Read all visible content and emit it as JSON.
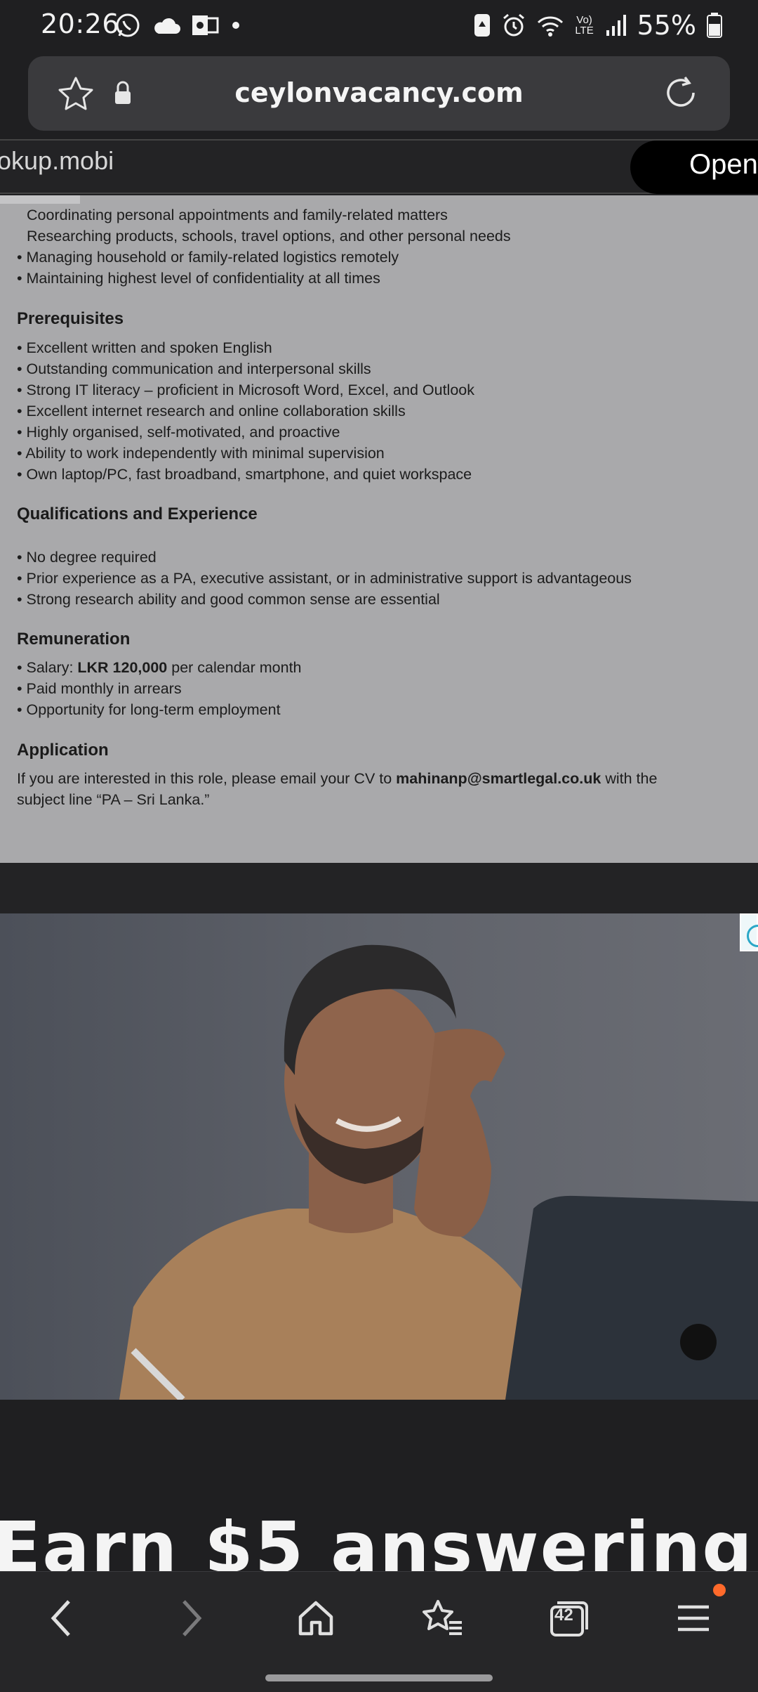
{
  "status_bar": {
    "time": "20:26",
    "battery": "55%",
    "network": "Vo) LTE"
  },
  "browser": {
    "url": "ceylonvacancy.com",
    "tabs_count": "42"
  },
  "ad_banner": {
    "domain": "okup.mobi",
    "open_label": "Open"
  },
  "article": {
    "duties_continued": [
      "Coordinating personal appointments and family-related matters",
      "Researching products, schools, travel options, and other personal needs",
      "• Managing household or family-related logistics remotely",
      "• Maintaining highest level of confidentiality at all times"
    ],
    "prerequisites_heading": "Prerequisites",
    "prerequisites": [
      "• Excellent written and spoken English",
      "• Outstanding communication and interpersonal skills",
      "• Strong IT literacy – proficient in Microsoft Word, Excel, and Outlook",
      "• Excellent internet research and online collaboration skills",
      "• Highly organised, self-motivated, and proactive",
      "• Ability to work independently with minimal supervision",
      "• Own laptop/PC, fast broadband, smartphone, and quiet workspace"
    ],
    "qualifications_heading": "Qualifications and Experience",
    "qualifications": [
      "• No degree required",
      "• Prior experience as a PA, executive assistant, or in administrative support is advantageous",
      "• Strong research ability and good common sense are essential"
    ],
    "remuneration_heading": "Remuneration",
    "salary_prefix": "• Salary: ",
    "salary_amount": "LKR 120,000",
    "salary_suffix": " per calendar month",
    "remuneration": [
      "• Paid monthly in arrears",
      "• Opportunity for long-term employment"
    ],
    "application_heading": "Application",
    "application_prefix": "If you are interested in this role, please email your CV to ",
    "application_email": "mahinanp@smartlegal.co.uk",
    "application_suffix": " with the",
    "application_line2": "subject line “PA – Sri Lanka.”"
  },
  "ad": {
    "headline": "Earn $5 answering"
  }
}
